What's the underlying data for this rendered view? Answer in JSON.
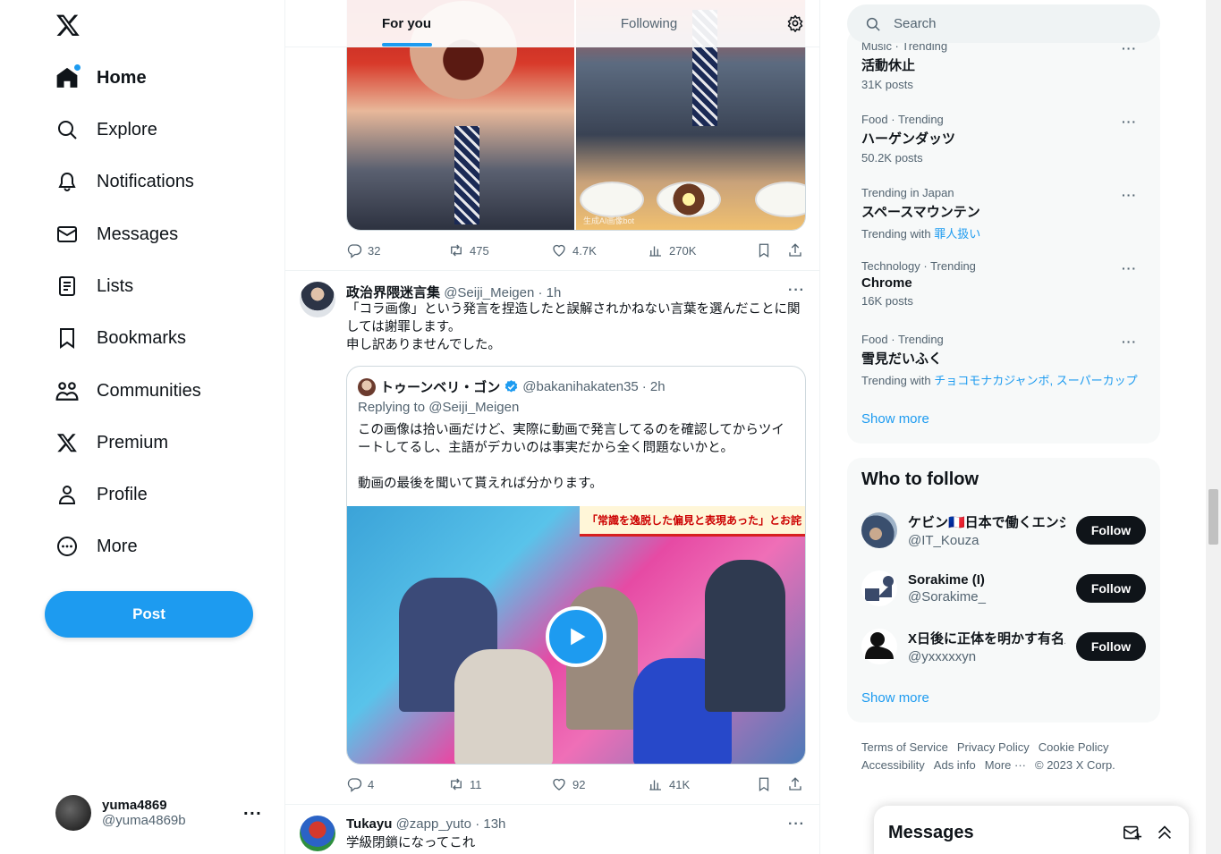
{
  "nav": {
    "items": [
      {
        "label": "Home"
      },
      {
        "label": "Explore"
      },
      {
        "label": "Notifications"
      },
      {
        "label": "Messages"
      },
      {
        "label": "Lists"
      },
      {
        "label": "Bookmarks"
      },
      {
        "label": "Communities"
      },
      {
        "label": "Premium"
      },
      {
        "label": "Profile"
      },
      {
        "label": "More"
      }
    ],
    "post_label": "Post"
  },
  "account": {
    "name": "yuma4869",
    "handle": "@yuma4869b"
  },
  "tabs": [
    {
      "label": "For you"
    },
    {
      "label": "Following"
    }
  ],
  "tweet1": {
    "replies": "32",
    "reposts": "475",
    "likes": "4.7K",
    "views": "270K",
    "watermark": "生成AI画像bot"
  },
  "tweet2": {
    "name": "政治界隈迷言集",
    "handle": "@Seiji_Meigen",
    "time": "· 1h",
    "text1": "「コラ画像」という発言を捏造したと誤解されかねない言葉を選んだことに関しては謝罪します。",
    "text2": "申し訳ありませんでした。",
    "quote": {
      "name": "トゥーンベリ・ゴン",
      "handle": "@bakanihakaten35",
      "time": "· 2h",
      "replying": "Replying to @Seiji_Meigen",
      "text1": "この画像は拾い画だけど、実際に動画で発言してるのを確認してからツイートしてるし、主語がデカいのは事実だから全く問題ないかと。",
      "text2": "動画の最後を聞いて貰えれば分かります。",
      "banner": "「常識を逸脱した偏見と表現あった」とお詫"
    },
    "replies": "4",
    "reposts": "11",
    "likes": "92",
    "views": "41K"
  },
  "tweet3": {
    "name": "Tukayu",
    "handle": "@zapp_yuto",
    "time": "· 13h",
    "text": "学級閉鎖になってこれ"
  },
  "search": {
    "placeholder": "Search"
  },
  "trends": [
    {
      "meta": "Music · Trending",
      "title": "活動休止",
      "count": "31K posts"
    },
    {
      "meta": "Food · Trending",
      "title": "ハーゲンダッツ",
      "count": "50.2K posts"
    },
    {
      "meta": "Trending in Japan",
      "title": "スペースマウンテン",
      "with_label": "Trending with",
      "links": "罪人扱い"
    },
    {
      "meta": "Technology · Trending",
      "title": "Chrome",
      "count": "16K posts"
    },
    {
      "meta": "Food · Trending",
      "title": "雪見だいふく",
      "with_label": "Trending with",
      "links": "チョコモナカジャンボ, スーパーカップ"
    }
  ],
  "trends_show_more": "Show more",
  "who_to_follow": {
    "title": "Who to follow",
    "users": [
      {
        "name": "ケビン🇫🇷日本で働くエンジニア",
        "handle": "@IT_Kouza",
        "button": "Follow"
      },
      {
        "name": "Sorakime (I)",
        "handle": "@Sorakime_",
        "button": "Follow"
      },
      {
        "name": "X日後に正体を明かす有名人",
        "handle": "@yxxxxxyn",
        "button": "Follow"
      }
    ],
    "show_more": "Show more"
  },
  "footer": {
    "links": [
      "Terms of Service",
      "Privacy Policy",
      "Cookie Policy",
      "Accessibility",
      "Ads info",
      "More ···"
    ],
    "copyright": "© 2023 X Corp."
  },
  "messages_drawer": {
    "title": "Messages"
  },
  "colors": {
    "accent": "#1d9bf0",
    "text": "#0f1419",
    "muted": "#536471"
  }
}
